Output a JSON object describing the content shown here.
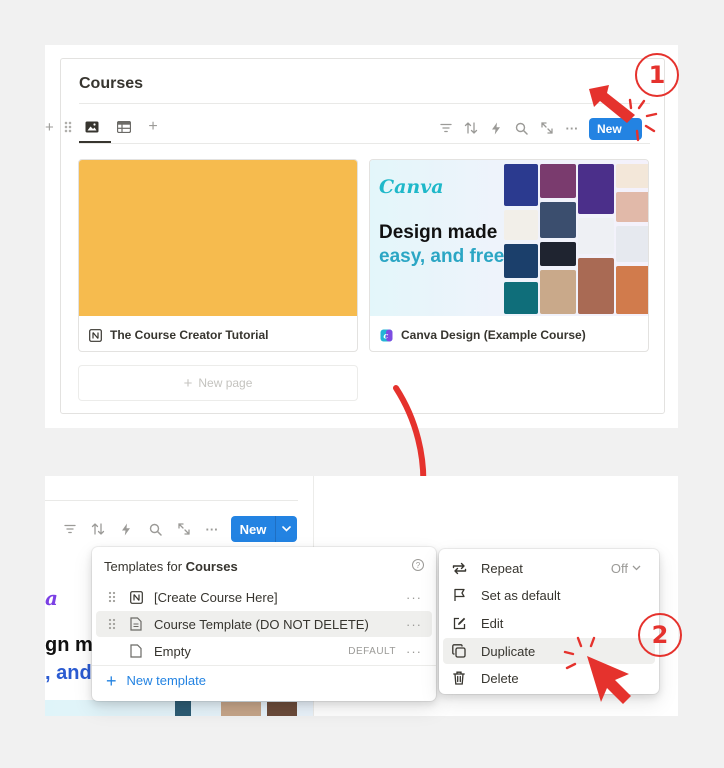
{
  "top": {
    "title": "Courses",
    "add_glyph": "+",
    "tabs": [
      {
        "icon": "gallery-view-icon",
        "active": true
      },
      {
        "icon": "table-view-icon",
        "active": false
      },
      {
        "icon": "add-view-icon",
        "label": "+"
      }
    ],
    "toolbar": {
      "icons": [
        "filter-icon",
        "sort-icon",
        "automation-icon",
        "search-icon",
        "expand-icon",
        "more-icon"
      ],
      "more_glyph": "···",
      "new_label": "New"
    },
    "cards": [
      {
        "title": "The Course Creator Tutorial",
        "icon": "notion-icon",
        "cover_color": "#f6bb4e"
      },
      {
        "title": "Canva Design (Example Course)",
        "icon": "canva-icon",
        "cover": {
          "brand": "Canva",
          "line1": "Design made",
          "line2": "easy, and free"
        }
      }
    ],
    "new_page_label": "New page",
    "new_page_glyph": "+",
    "step_marker": "1"
  },
  "bottom": {
    "toolbar": {
      "icons": [
        "filter-icon",
        "sort-icon",
        "automation-icon",
        "search-icon",
        "expand-icon",
        "more-icon"
      ],
      "more_glyph": "···",
      "new_label": "New"
    },
    "bg_text": {
      "a": "a",
      "b": "gn m",
      "c": ", and"
    },
    "templates_menu": {
      "header_prefix": "Templates for ",
      "header_db": "Courses",
      "help_glyph": "?",
      "items": [
        {
          "label": "[Create Course Here]",
          "icon": "notion-icon",
          "badge": "",
          "more": "···"
        },
        {
          "label": "Course Template (DO NOT DELETE)",
          "icon": "page-icon",
          "badge": "",
          "more": "···"
        },
        {
          "label": "Empty",
          "icon": "page-icon",
          "badge": "DEFAULT",
          "more": "···"
        }
      ],
      "new_template_label": "New template",
      "new_template_glyph": "+"
    },
    "context_menu": {
      "items": [
        {
          "label": "Repeat",
          "icon": "repeat-icon",
          "value": "Off"
        },
        {
          "label": "Set as default",
          "icon": "flag-icon"
        },
        {
          "label": "Edit",
          "icon": "edit-icon"
        },
        {
          "label": "Duplicate",
          "icon": "duplicate-icon"
        },
        {
          "label": "Delete",
          "icon": "trash-icon"
        }
      ]
    },
    "step_marker": "2"
  },
  "colors": {
    "accent": "#2383e2",
    "annotation": "#e5322d",
    "cover_yellow": "#f6bb4e"
  }
}
